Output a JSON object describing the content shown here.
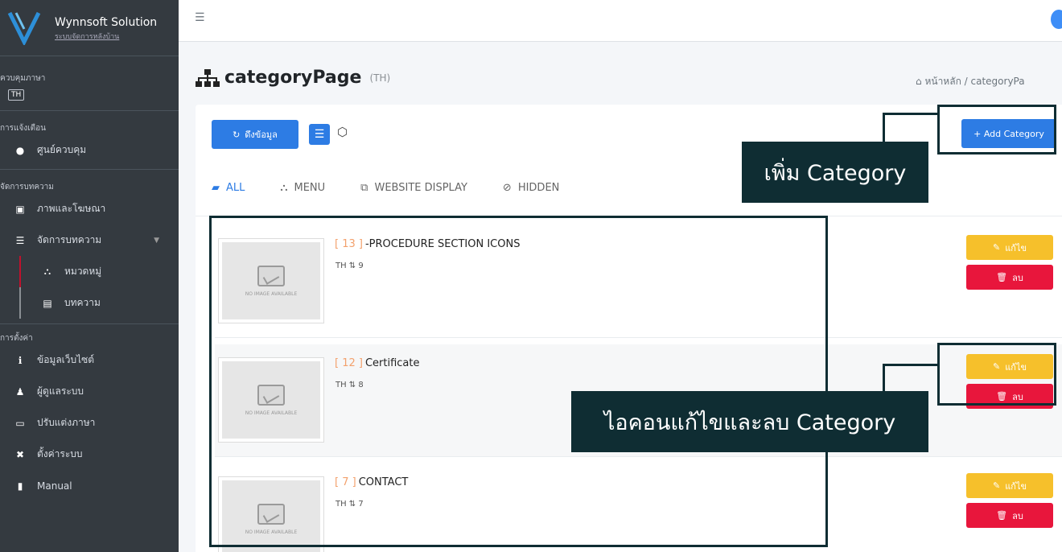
{
  "sidebar": {
    "brand_name": "Wynnsoft Solution",
    "brand_sub": "ระบบจัดการหลังบ้าน",
    "sections": {
      "language": "ควบคุมภาษา",
      "language_badge": "TH",
      "notifications": "การแจ้งเตือน",
      "articles": "จัดการบทความ",
      "settings": "การตั้งค่า"
    },
    "items": {
      "control_center": "ศูนย์ควบคุม",
      "media": "ภาพและโฆษณา",
      "manage_articles": "จัดการบทความ",
      "category": "หมวดหมู่",
      "article": "บทความ",
      "website_info": "ข้อมูลเว็บไซต์",
      "users": "ผู้ดูแลระบบ",
      "language_edit": "ปรับแต่งภาษา",
      "system_settings": "ตั้งค่าระบบ",
      "manual": "Manual"
    }
  },
  "header": {
    "title": "categoryPage",
    "title_suffix": "(TH)",
    "breadcrumb": "หน้าหลัก / categoryPa"
  },
  "toolbar": {
    "fetch_label": "ดึงข้อมูล",
    "add_label": "+ Add Category"
  },
  "tabs": [
    {
      "label": "ALL"
    },
    {
      "label": "MENU"
    },
    {
      "label": "WEBSITE DISPLAY"
    },
    {
      "label": "HIDDEN"
    }
  ],
  "rows": [
    {
      "num": "[ 13 ]",
      "title": "-PROCEDURE SECTION ICONS",
      "meta": "TH ⇅ 9",
      "edit": "แก้ไข",
      "delete": "ลบ",
      "thumb": "NO IMAGE AVAILABLE"
    },
    {
      "num": "[ 12 ]",
      "title": "Certificate",
      "meta": "TH ⇅ 8",
      "edit": "แก้ไข",
      "delete": "ลบ",
      "thumb": "NO IMAGE AVAILABLE"
    },
    {
      "num": "[ 7 ]",
      "title": "CONTACT",
      "meta": "TH ⇅ 7",
      "edit": "แก้ไข",
      "delete": "ลบ",
      "thumb": "NO IMAGE AVAILABLE"
    }
  ],
  "annotations": {
    "add_category": "เพิ่ม Category",
    "edit_delete": "ไอคอนแก้ไขและลบ Category"
  },
  "colors": {
    "primary": "#2d7ce4",
    "warning": "#f6c02b",
    "danger": "#e8163c",
    "sidebar": "#343a40",
    "annotation": "#0f2d33"
  }
}
